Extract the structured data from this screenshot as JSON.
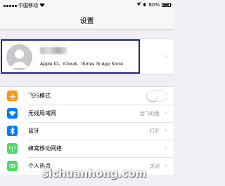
{
  "status_bar": {
    "carrier": "中国移动",
    "time": "",
    "battery": "80%",
    "battery_level": 0.8
  },
  "nav": {
    "title": "设置"
  },
  "profile": {
    "name": "",
    "subtitle": "Apple ID、iCloud、iTunes 与 App Store"
  },
  "settings": [
    {
      "label": "飞行模式",
      "value": "",
      "icon": "airplane-icon",
      "icon_color": "#ff9500",
      "toggle_on": false
    },
    {
      "label": "无线局域网",
      "value": "会飞的鱼",
      "icon": "wifi-icon",
      "icon_color": "#007aff"
    },
    {
      "label": "蓝牙",
      "value": "打开",
      "icon": "bluetooth-icon",
      "icon_color": "#007aff"
    },
    {
      "label": "蜂窝移动网络",
      "value": "",
      "icon": "cellular-icon",
      "icon_color": "#4cd964"
    },
    {
      "label": "个人热点",
      "value": "关闭",
      "icon": "hotspot-icon",
      "icon_color": "#4cd964"
    }
  ],
  "watermark": "sichuanhong.com",
  "colors": {
    "highlight_border": "#1d2d6e",
    "background": "#efeff4"
  }
}
